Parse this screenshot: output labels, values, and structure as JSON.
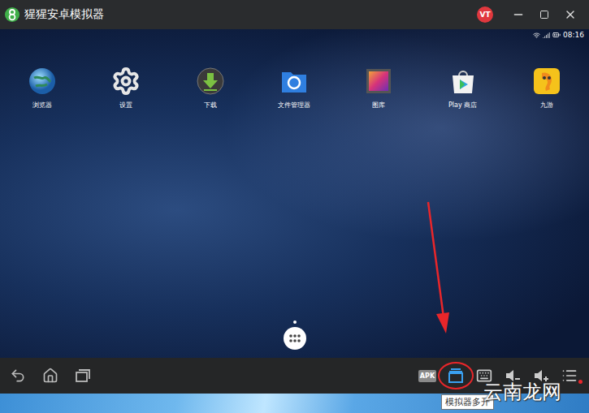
{
  "window": {
    "title": "猩猩安卓模拟器",
    "badge": "VT"
  },
  "status_bar": {
    "time": "08:16"
  },
  "desktop_icons": [
    {
      "label": "浏览器",
      "kind": "browser"
    },
    {
      "label": "设置",
      "kind": "settings"
    },
    {
      "label": "下载",
      "kind": "download"
    },
    {
      "label": "文件管理器",
      "kind": "files"
    },
    {
      "label": "图库",
      "kind": "gallery"
    },
    {
      "label": "Play 商店",
      "kind": "play"
    },
    {
      "label": "九游",
      "kind": "jiuyou"
    }
  ],
  "nav_buttons": [
    {
      "kind": "back"
    },
    {
      "kind": "home"
    },
    {
      "kind": "recents"
    }
  ],
  "tool_buttons": [
    {
      "kind": "apk",
      "label": "APK",
      "highlighted": false
    },
    {
      "kind": "multi",
      "label": "",
      "highlighted": true
    },
    {
      "kind": "keyboard",
      "label": "",
      "highlighted": false
    },
    {
      "kind": "volume-down",
      "label": "",
      "highlighted": false
    },
    {
      "kind": "volume-up",
      "label": "",
      "highlighted": false
    },
    {
      "kind": "menu",
      "label": "",
      "highlighted": false,
      "notification": true
    }
  ],
  "tooltip": "模拟器多开",
  "watermark": "云南龙网"
}
